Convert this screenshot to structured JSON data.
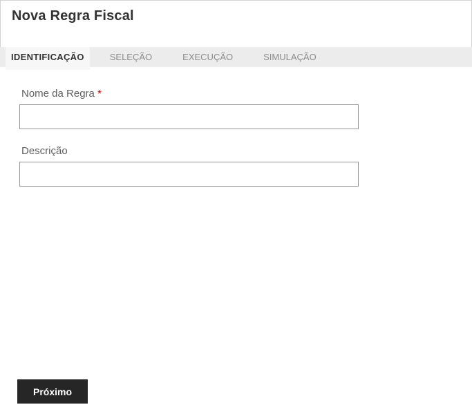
{
  "page": {
    "title": "Nova Regra Fiscal"
  },
  "tabs": [
    {
      "label": "IDENTIFICAÇÃO",
      "active": true
    },
    {
      "label": "SELEÇÃO",
      "active": false
    },
    {
      "label": "EXECUÇÃO",
      "active": false
    },
    {
      "label": "SIMULAÇÃO",
      "active": false
    }
  ],
  "form": {
    "fields": [
      {
        "label": "Nome da Regra",
        "required_marker": "*",
        "value": "",
        "placeholder": ""
      },
      {
        "label": "Descrição",
        "required_marker": "",
        "value": "",
        "placeholder": ""
      }
    ]
  },
  "footer": {
    "next_button_label": "Próximo"
  },
  "colors": {
    "button_bg": "#262626",
    "button_text": "#ffffff",
    "required_asterisk": "#cc0000",
    "tabbar_bg": "#ececec",
    "active_tab_bg": "#f7f7f7",
    "active_tab_text": "#333333",
    "inactive_tab_text": "#8c8c8c",
    "input_border": "#949494",
    "label_text": "#5f5f5f",
    "title_text": "#333333"
  }
}
